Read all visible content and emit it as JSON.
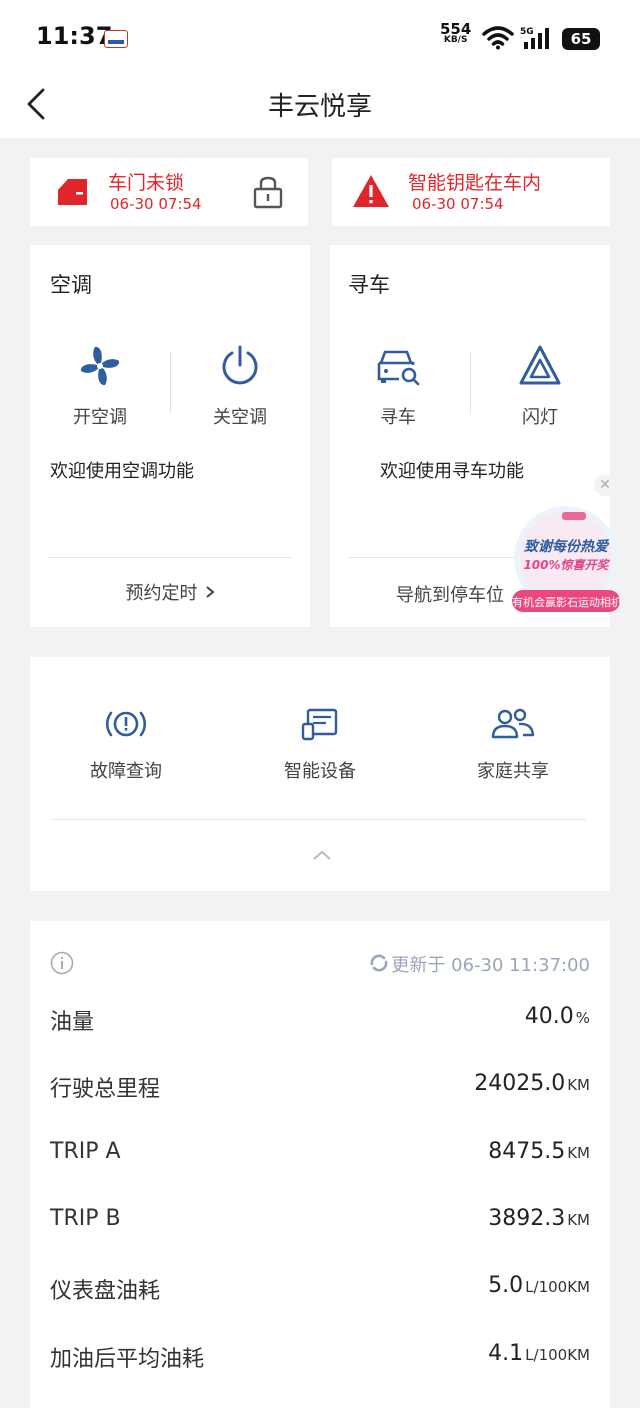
{
  "status_bar": {
    "time": "11:37",
    "net_speed": "554",
    "net_unit": "KB/S",
    "network": "5G",
    "battery": "65"
  },
  "header": {
    "title": "丰云悦享"
  },
  "alerts": [
    {
      "icon": "car-door-icon",
      "title": "车门未锁",
      "time": "06-30 07:54"
    },
    {
      "icon": "warning-icon",
      "title": "智能钥匙在车内",
      "time": "06-30 07:54"
    }
  ],
  "ac": {
    "title": "空调",
    "on_label": "开空调",
    "off_label": "关空调",
    "welcome": "欢迎使用空调功能",
    "schedule": "预约定时"
  },
  "find_car": {
    "title": "寻车",
    "find_label": "寻车",
    "flash_label": "闪灯",
    "welcome": "欢迎使用寻车功能",
    "navigate": "导航到停车位"
  },
  "functions": [
    {
      "icon": "fault-query-icon",
      "label": "故障查询"
    },
    {
      "icon": "smart-device-icon",
      "label": "智能设备"
    },
    {
      "icon": "family-share-icon",
      "label": "家庭共享"
    }
  ],
  "vehicle_stats": {
    "updated": "更新于 06-30 11:37:00",
    "rows": [
      {
        "label": "油量",
        "value": "40.0",
        "unit": "%"
      },
      {
        "label": "行驶总里程",
        "value": "24025.0",
        "unit": "KM"
      },
      {
        "label": "TRIP A",
        "value": "8475.5",
        "unit": "KM"
      },
      {
        "label": "TRIP B",
        "value": "3892.3",
        "unit": "KM"
      },
      {
        "label": "仪表盘油耗",
        "value": "5.0",
        "unit": "L/100KM"
      },
      {
        "label": "加油后平均油耗",
        "value": "4.1",
        "unit": "L/100KM"
      }
    ]
  },
  "promo": {
    "line1": "致谢每份热爱",
    "line2": "100%惊喜开奖",
    "button": "有机会赢影石运动相机"
  },
  "colors": {
    "alert_red": "#e0262b",
    "icon_blue": "#2f5d9e",
    "background": "#f2f2f4"
  }
}
